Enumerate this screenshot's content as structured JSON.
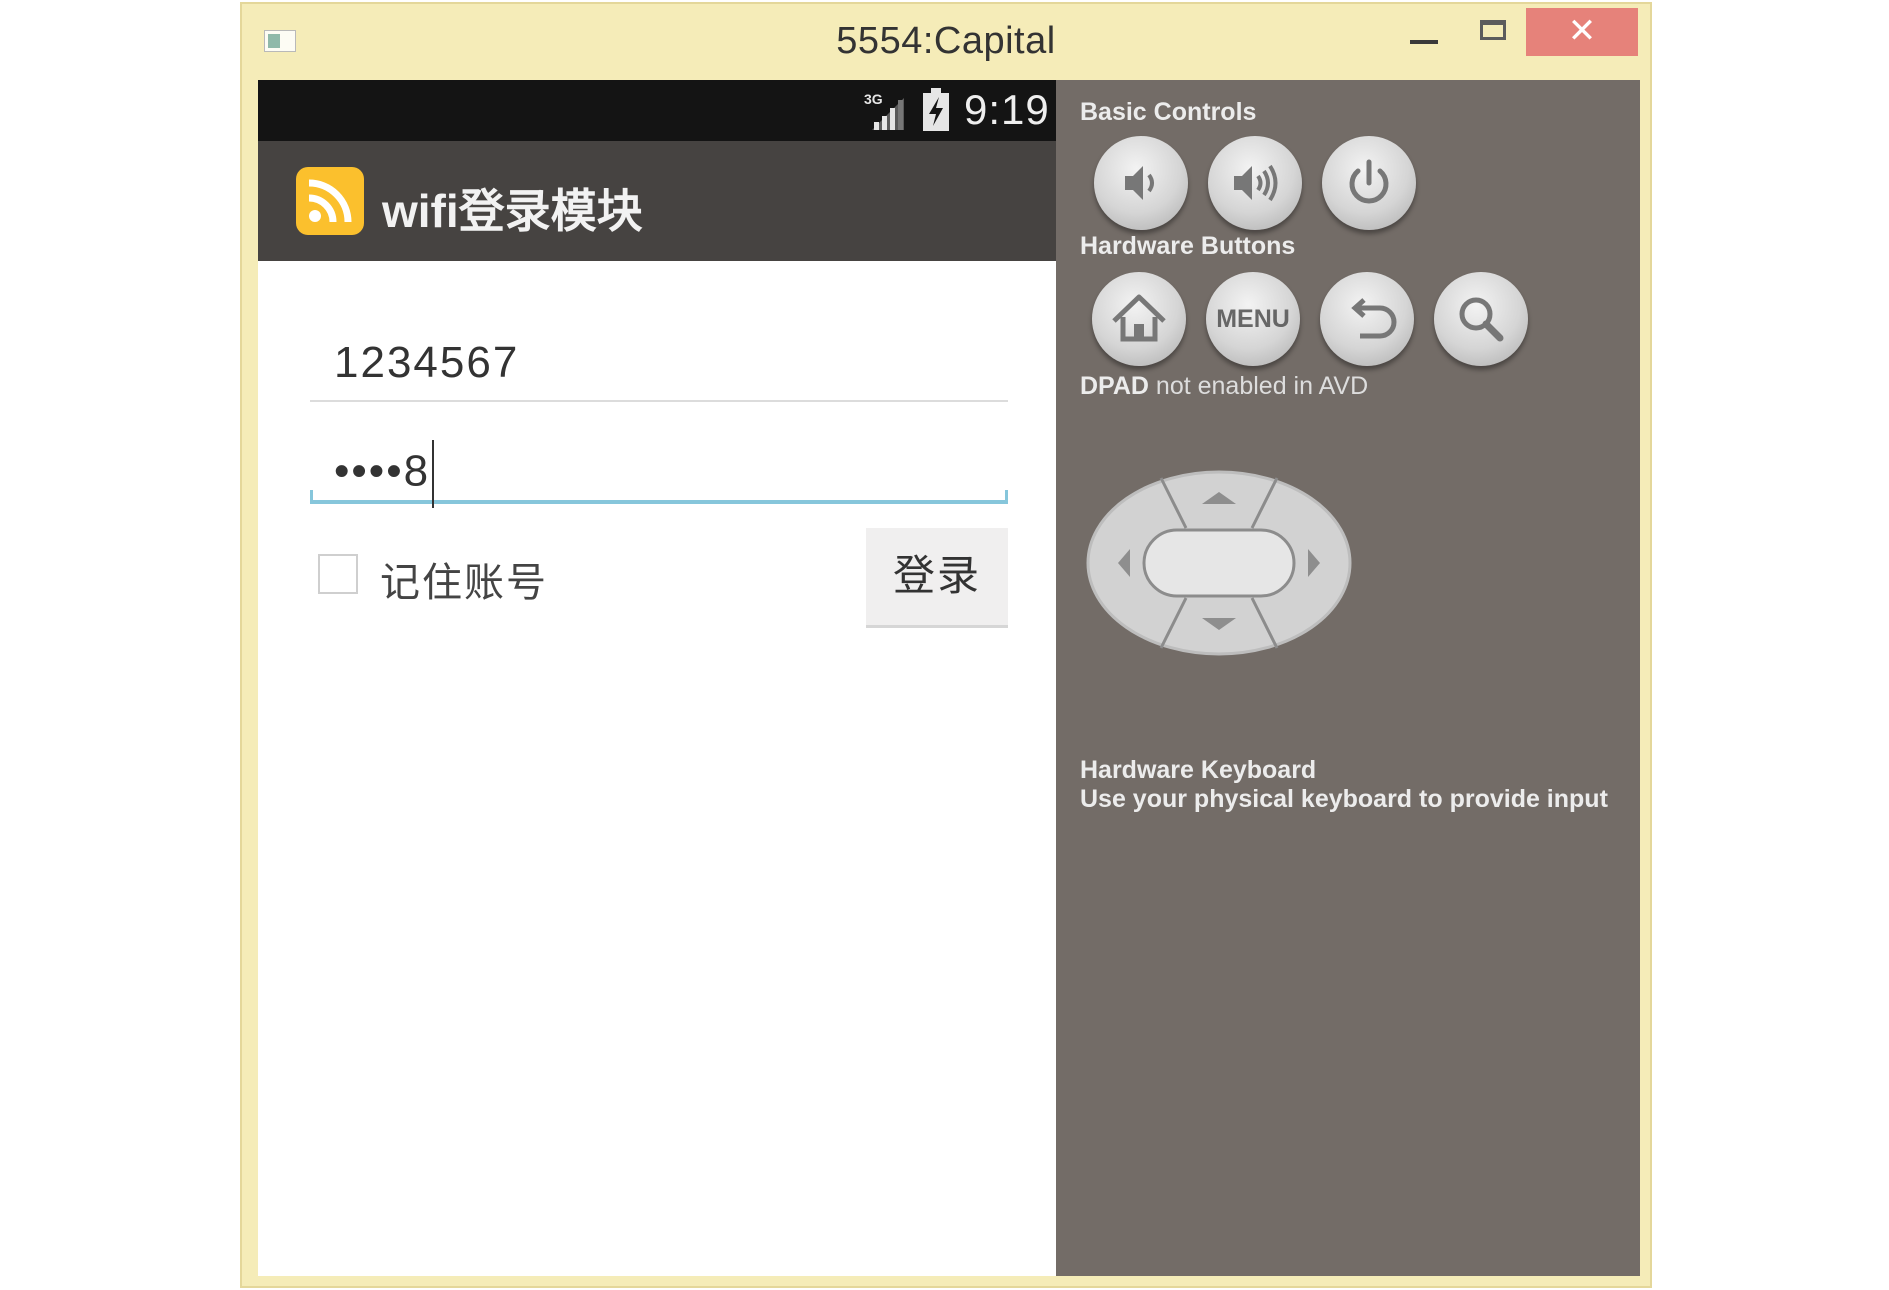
{
  "window": {
    "title": "5554:Capital",
    "close_glyph": "✕",
    "icon": "app-window-icon",
    "close_color": "#e6827a"
  },
  "emulator": {
    "status_bar": {
      "network_label": "3G",
      "time": "9:19"
    },
    "action_bar": {
      "app_title": "wifi登录模块",
      "app_icon": "rss-icon",
      "icon_color": "#fbc02d"
    },
    "form": {
      "username_value": "1234567",
      "password_value": "••••8",
      "remember_label": "记住账号",
      "remember_checked": false,
      "login_label": "登录",
      "focus_color": "#86c6db"
    }
  },
  "controls": {
    "basic_controls_label": "Basic Controls",
    "basic_buttons": [
      "volume-down-icon",
      "volume-up-icon",
      "power-icon"
    ],
    "hardware_buttons_label": "Hardware Buttons",
    "hardware_buttons": [
      "home-icon",
      "menu-button",
      "back-icon",
      "search-icon"
    ],
    "menu_label": "MENU",
    "dpad_label_bold": "DPAD",
    "dpad_label_rest": " not enabled in AVD",
    "keyboard_title": "Hardware Keyboard",
    "keyboard_desc": "Use your physical keyboard to provide input",
    "panel_color": "#736c67"
  }
}
